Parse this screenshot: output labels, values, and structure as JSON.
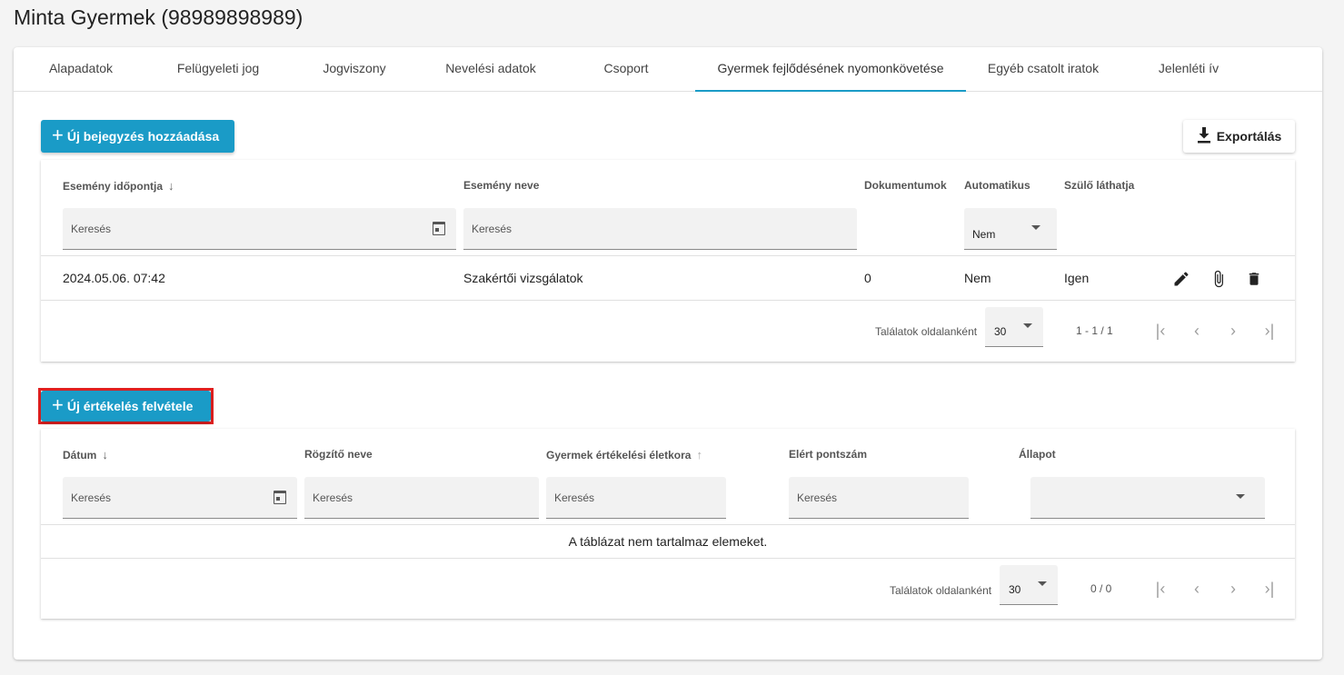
{
  "page": {
    "title": "Minta Gyermek (98989898989)"
  },
  "tabs": [
    {
      "label": "Alapadatok"
    },
    {
      "label": "Felügyeleti jog"
    },
    {
      "label": "Jogviszony"
    },
    {
      "label": "Nevelési adatok"
    },
    {
      "label": "Csoport"
    },
    {
      "label": "Gyermek fejlődésének nyomonkövetése",
      "active": true
    },
    {
      "label": "Egyéb csatolt iratok"
    },
    {
      "label": "Jelenléti ív"
    }
  ],
  "events": {
    "add_button": "Új bejegyzés hozzáadása",
    "export_button": "Exportálás",
    "columns": {
      "date": "Esemény időpontja",
      "name": "Esemény neve",
      "documents": "Dokumentumok",
      "automatic": "Automatikus",
      "parent_visible": "Szülő láthatja"
    },
    "filters": {
      "date_placeholder": "Keresés",
      "name_placeholder": "Keresés",
      "automatic_value": "Nem"
    },
    "rows": [
      {
        "date": "2024.05.06. 07:42",
        "name": "Szakértői vizsgálatok",
        "documents": "0",
        "automatic": "Nem",
        "parent_visible": "Igen"
      }
    ],
    "pagination": {
      "per_page_label": "Találatok oldalanként",
      "per_page": "30",
      "range": "1 - 1 / 1"
    }
  },
  "evaluations": {
    "add_button": "Új értékelés felvétele",
    "columns": {
      "date": "Dátum",
      "recorder": "Rögzítő neve",
      "age": "Gyermek értékelési életkora",
      "score": "Elért pontszám",
      "status": "Állapot"
    },
    "filters": {
      "date_placeholder": "Keresés",
      "recorder_placeholder": "Keresés",
      "age_placeholder": "Keresés",
      "score_placeholder": "Keresés"
    },
    "empty_text": "A táblázat nem tartalmaz elemeket.",
    "pagination": {
      "per_page_label": "Találatok oldalanként",
      "per_page": "30",
      "range": "0 / 0"
    }
  },
  "icons": {
    "plus": "plus-icon",
    "download": "download-icon",
    "calendar": "calendar-icon",
    "edit": "pencil-icon",
    "attach": "paperclip-icon",
    "delete": "trash-icon"
  },
  "colors": {
    "accent": "#1a9bc7",
    "highlight": "#e02020"
  }
}
